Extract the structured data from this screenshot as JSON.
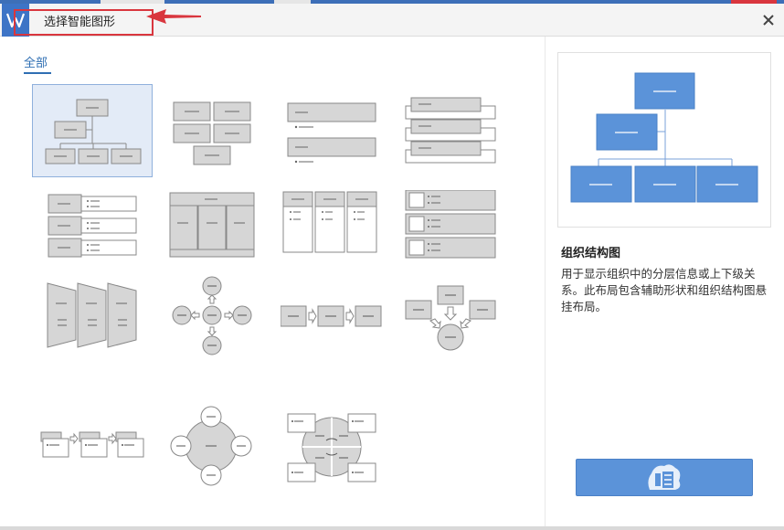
{
  "colors": {
    "accent": "#2f6fb3",
    "selected_bg": "#e3ebf7",
    "preview_shape": "#5b93d9",
    "button": "#5b93d9",
    "annotation_red": "#d9363e"
  },
  "window": {
    "title": "选择智能图形",
    "logo_icon": "wps-logo-icon",
    "close_icon": "close-icon"
  },
  "category": {
    "label": "全部"
  },
  "selected": {
    "name": "组织结构图",
    "description": "用于显示组织中的分层信息或上下级关系。此布局包含辅助形状和组织结构图悬挂布局。"
  },
  "insert_button": {
    "icon": "insert-icon"
  },
  "templates": [
    {
      "id": "org-chart"
    },
    {
      "id": "block-list"
    },
    {
      "id": "vertical-bullet-list"
    },
    {
      "id": "stacked-list"
    },
    {
      "id": "vertical-box-list"
    },
    {
      "id": "table-hierarchy"
    },
    {
      "id": "column-list"
    },
    {
      "id": "picture-list"
    },
    {
      "id": "chevron-panels"
    },
    {
      "id": "radial-cycle"
    },
    {
      "id": "basic-process"
    },
    {
      "id": "converging-arrows"
    },
    {
      "id": "step-process"
    },
    {
      "id": "radial-circles"
    },
    {
      "id": "segmented-cycle"
    }
  ]
}
